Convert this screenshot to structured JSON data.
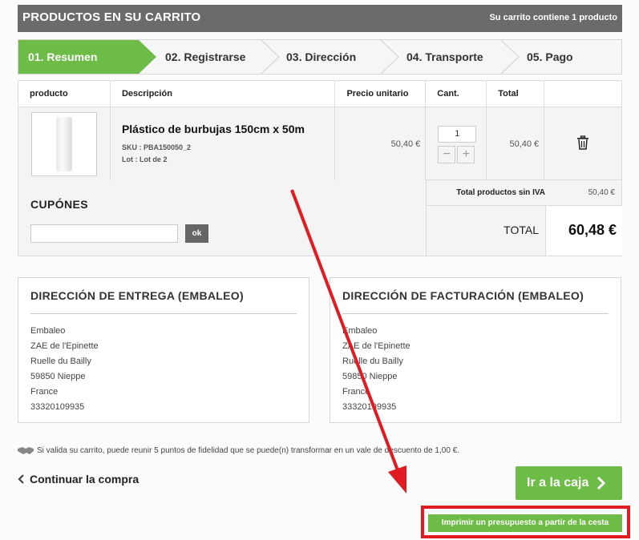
{
  "header": {
    "title": "PRODUCTOS EN SU CARRITO",
    "cart_info": "Su carrito contiene 1 producto"
  },
  "steps": [
    {
      "label": "01. Resumen",
      "active": true
    },
    {
      "label": "02. Registrarse",
      "active": false
    },
    {
      "label": "03. Dirección",
      "active": false
    },
    {
      "label": "04. Transporte",
      "active": false
    },
    {
      "label": "05. Pago",
      "active": false
    }
  ],
  "cart": {
    "columns": [
      "producto",
      "Descripción",
      "Precio unitario",
      "Cant.",
      "Total"
    ],
    "item": {
      "name": "Plástico de burbujas 150cm x 50m",
      "sku": "SKU : PBA150050_2",
      "lot": "Lot : Lot de 2",
      "unit_price": "50,40 €",
      "quantity": "1",
      "minus": "−",
      "plus": "+",
      "total": "50,40 €",
      "delete_icon": "trash-icon"
    }
  },
  "coupons": {
    "title": "CUPÓNES",
    "input_value": "",
    "ok_label": "ok"
  },
  "totals": {
    "subtotal_label": "Total productos sin IVA",
    "subtotal_value": "50,40 €",
    "total_label": "TOTAL",
    "total_value": "60,48 €"
  },
  "delivery_address": {
    "title": "DIRECCIÓN DE ENTREGA (EMBALEO)",
    "lines": [
      "Embaleo",
      "ZAE de l'Epinette",
      "Ruelle du Bailly",
      "59850 Nieppe",
      "France",
      "33320109935"
    ]
  },
  "billing_address": {
    "title": "DIRECCIÓN DE FACTURACIÓN (EMBALEO)",
    "lines": [
      "Embaleo",
      "ZAE de l'Epinette",
      "Ruelle du Bailly",
      "59850 Nieppe",
      "France",
      "33320109935"
    ]
  },
  "loyalty": {
    "icon": "handshake-icon",
    "text": "Si valida su carrito, puede reunir 5 puntos de fidelidad que se puede(n) transformar en un vale de descuento de 1,00 €."
  },
  "actions": {
    "continue_label": "Continuar la compra",
    "checkout_label": "Ir a la caja",
    "print_quote_label": "Imprimir un presupuesto a partir de la cesta"
  },
  "colors": {
    "accent_green": "#6cbc47",
    "header_gray": "#6b6b6b",
    "annotation_red": "#e11b22"
  }
}
